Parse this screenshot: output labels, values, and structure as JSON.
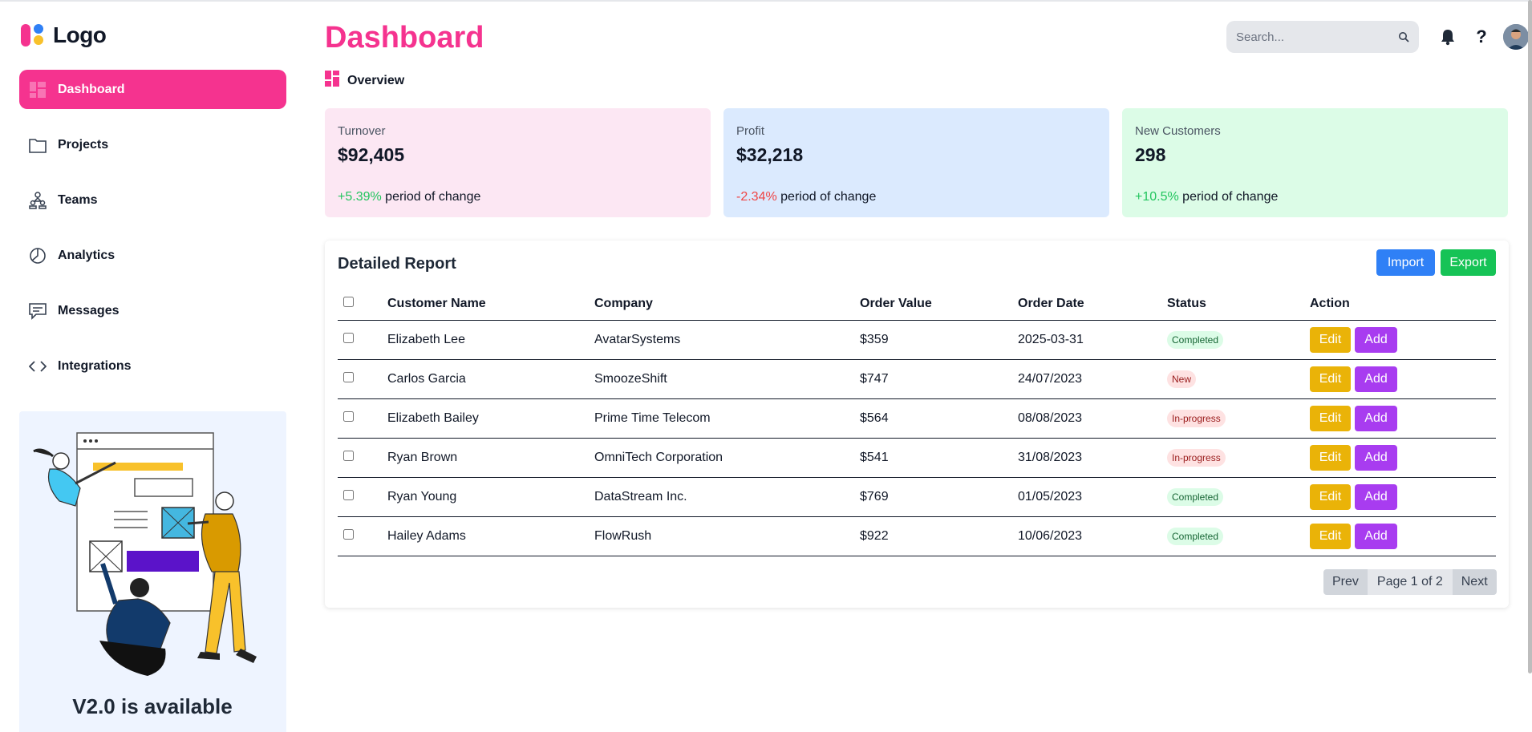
{
  "sidebar": {
    "logo_text": "Logo",
    "items": [
      {
        "label": "Dashboard",
        "icon": "dashboard-grid-icon",
        "active": true
      },
      {
        "label": "Projects",
        "icon": "folder-icon"
      },
      {
        "label": "Teams",
        "icon": "teams-icon"
      },
      {
        "label": "Analytics",
        "icon": "pie-chart-icon"
      },
      {
        "label": "Messages",
        "icon": "message-icon"
      },
      {
        "label": "Integrations",
        "icon": "code-icon"
      }
    ],
    "promo_text": "V2.0 is available"
  },
  "header": {
    "title": "Dashboard",
    "search_placeholder": "Search...",
    "help_label": "?"
  },
  "overview": {
    "label": "Overview"
  },
  "cards": [
    {
      "label": "Turnover",
      "value": "$92,405",
      "change": "+5.39%",
      "change_suffix": " period of change",
      "bg": "#fce7f3"
    },
    {
      "label": "Profit",
      "value": "$32,218",
      "change": "-2.34%",
      "change_suffix": " period of change",
      "bg": "#dbeafe"
    },
    {
      "label": "New Customers",
      "value": "298",
      "change": "+10.5%",
      "change_suffix": " period of change",
      "bg": "#dcfce7"
    }
  ],
  "report": {
    "title": "Detailed Report",
    "import_label": "Import",
    "export_label": "Export",
    "columns": [
      "Customer Name",
      "Company",
      "Order Value",
      "Order Date",
      "Status",
      "Action"
    ],
    "rows": [
      {
        "name": "Elizabeth Lee",
        "company": "AvatarSystems",
        "value": "$359",
        "date": "2025-03-31",
        "status": "Completed"
      },
      {
        "name": "Carlos Garcia",
        "company": "SmoozeShift",
        "value": "$747",
        "date": "24/07/2023",
        "status": "New"
      },
      {
        "name": "Elizabeth Bailey",
        "company": "Prime Time Telecom",
        "value": "$564",
        "date": "08/08/2023",
        "status": "In-progress"
      },
      {
        "name": "Ryan Brown",
        "company": "OmniTech Corporation",
        "value": "$541",
        "date": "31/08/2023",
        "status": "In-progress"
      },
      {
        "name": "Ryan Young",
        "company": "DataStream Inc.",
        "value": "$769",
        "date": "01/05/2023",
        "status": "Completed"
      },
      {
        "name": "Hailey Adams",
        "company": "FlowRush",
        "value": "$922",
        "date": "10/06/2023",
        "status": "Completed"
      }
    ],
    "edit_label": "Edit",
    "add_label": "Add",
    "pagination": {
      "prev": "Prev",
      "info": "Page 1 of 2",
      "next": "Next"
    }
  },
  "colors": {
    "accent": "#f5338f",
    "import": "#2f80f6",
    "export": "#16c356",
    "edit": "#eab308",
    "add": "#a83cf0"
  }
}
